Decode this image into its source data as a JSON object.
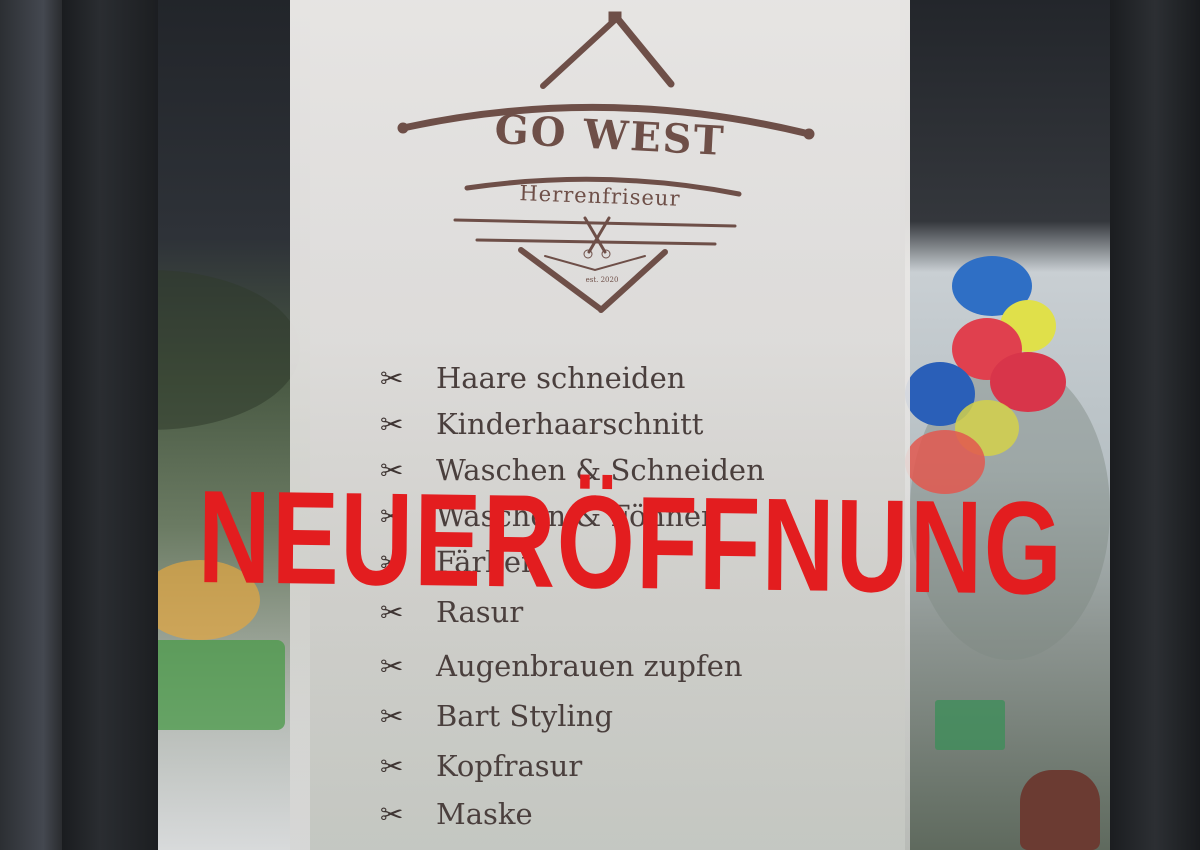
{
  "shop": {
    "name": "GO WEST",
    "subtitle": "Herrenfriseur",
    "established": "est. 2020"
  },
  "banner": {
    "text": "NEUERÖFFNUNG",
    "color": "#e31d1f"
  },
  "services": [
    {
      "icon": "scissors-icon",
      "label": "Haare schneiden"
    },
    {
      "icon": "scissors-icon",
      "label": "Kinderhaarschnitt"
    },
    {
      "icon": "scissors-icon",
      "label": "Waschen & Schneiden"
    },
    {
      "icon": "scissors-icon",
      "label": "Waschen & Föhnen"
    },
    {
      "icon": "scissors-icon",
      "label": "Färben"
    },
    {
      "icon": "scissors-icon",
      "label": "Rasur"
    },
    {
      "icon": "scissors-icon",
      "label": "Augenbrauen zupfen"
    },
    {
      "icon": "scissors-icon",
      "label": "Bart Styling"
    },
    {
      "icon": "scissors-icon",
      "label": "Kopfrasur"
    },
    {
      "icon": "scissors-icon",
      "label": "Maske"
    }
  ],
  "colors": {
    "logo": "#6e4f48",
    "text": "#4a3f3d"
  }
}
